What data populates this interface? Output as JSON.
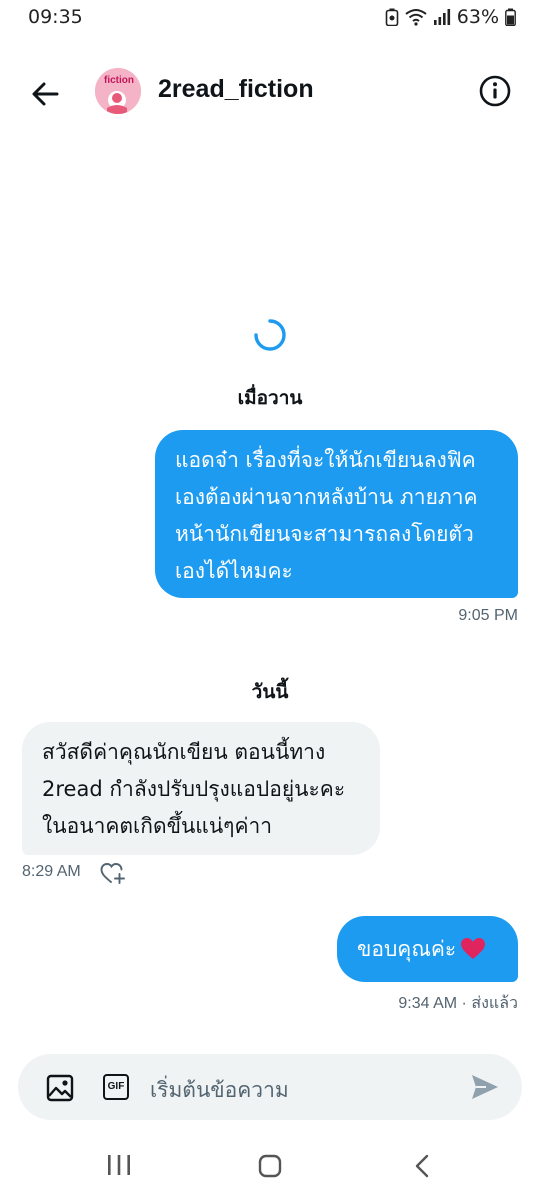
{
  "status_bar": {
    "time": "09:35",
    "battery": "63%"
  },
  "header": {
    "title": "2read_fiction",
    "avatar_text": "fiction"
  },
  "thread": {
    "sep_yesterday": "เมื่อวาน",
    "msg1": {
      "lines": [
        "แอดจ๋า เรื่องที่จะให้นักเขียนลงฟิค",
        "เองต้องผ่านจากหลังบ้าน ภายภาค",
        "หน้านักเขียนจะสามารถลงโดยตัว",
        "เองได้ไหมคะ"
      ],
      "time": "9:05 PM"
    },
    "sep_today": "วันนี้",
    "msg2": {
      "lines": [
        "สวัสดีค่าคุณนักเขียน ตอนนี้ทาง",
        "2read กำลังปรับปรุงแอปอยู่นะคะ",
        "ในอนาคตเกิดขึ้นแน่ๆค่าา"
      ],
      "time": "8:29 AM"
    },
    "msg3": {
      "text": "ขอบคุณค่ะ",
      "time_status": "9:34 AM · ส่งแล้ว"
    }
  },
  "composer": {
    "placeholder": "เริ่มต้นข้อความ",
    "gif_label": "GIF"
  },
  "colors": {
    "accent": "#1d9bf0",
    "incoming_bg": "#eff3f4",
    "heart": "#e0245e"
  },
  "icons": [
    "back-arrow-icon",
    "info-icon",
    "loading-spinner-icon",
    "add-reaction-heart-icon",
    "image-icon",
    "gif-icon",
    "send-icon",
    "recent-apps-icon",
    "home-icon",
    "back-nav-icon"
  ]
}
